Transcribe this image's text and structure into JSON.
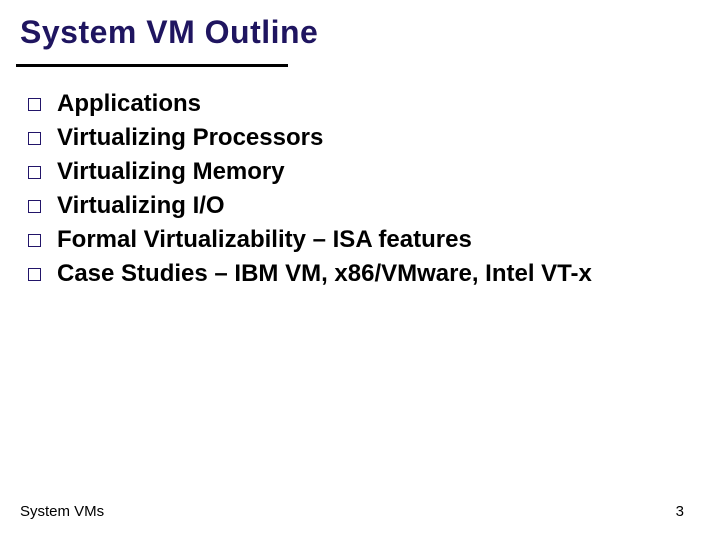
{
  "title": "System VM Outline",
  "items": [
    "Applications",
    "Virtualizing Processors",
    "Virtualizing Memory",
    "Virtualizing I/O",
    "Formal Virtualizability – ISA features",
    "Case Studies – IBM VM, x86/VMware, Intel VT-x"
  ],
  "footer": {
    "left": "System VMs",
    "right": "3"
  }
}
